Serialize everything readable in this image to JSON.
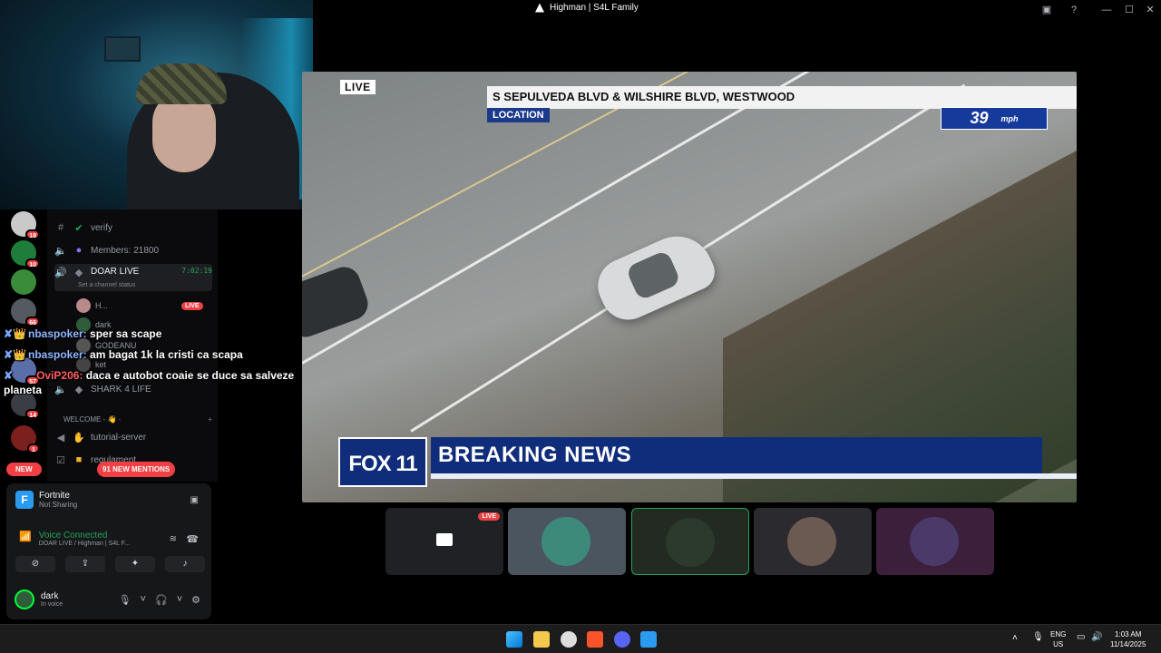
{
  "window": {
    "title": "Highman | S4L Family",
    "controls": {
      "minimize": "—",
      "maximize": "☐",
      "close": "✕"
    }
  },
  "servers": [
    {
      "badge": "18",
      "color": "#c9c9c9"
    },
    {
      "badge": "10",
      "color": "#1e7d3b"
    },
    {
      "badge": "",
      "color": "#3a8b3a"
    },
    {
      "badge": "66",
      "color": "#555a60"
    },
    {
      "badge": "57",
      "color": "#5a6fa8"
    },
    {
      "badge": "14",
      "color": "#3b3d44"
    },
    {
      "badge": "1",
      "color": "#7b1f1f"
    }
  ],
  "channels": {
    "verify": "verify",
    "members": "Members: 21800",
    "doar_live": "DOAR LIVE",
    "doar_live_timer": "7:02:19",
    "channel_status": "Set a channel status",
    "shark": "SHARK 4 LIFE",
    "welcome_category": "WELCOME - 👋 ·",
    "tutorial": "tutorial-server",
    "regulament": "regulament",
    "voice_users": [
      {
        "name": "H...",
        "live": "LIVE"
      },
      {
        "name": "dark",
        "live": ""
      },
      {
        "name": "GODEANU",
        "live": ""
      },
      {
        "name": "ket",
        "live": ""
      }
    ]
  },
  "chat": [
    {
      "user": "nbaspoker:",
      "message": "sper sa scape",
      "user_color": "#8fb6ff"
    },
    {
      "user": "nbaspoker:",
      "message": "am bagat 1k la cristi ca scapa",
      "user_color": "#8fb6ff"
    },
    {
      "user": "OviP206:",
      "message": "daca e autobot coaie se duce sa salveze planeta",
      "user_color": "#ff5c5c"
    }
  ],
  "pills": {
    "new": "NEW",
    "mentions": "91 NEW MENTIONS"
  },
  "panel": {
    "activity_name": "Fortnite",
    "activity_status": "Not Sharing",
    "voice_status": "Voice Connected",
    "voice_location": "DOAR LIVE / Highman | S4L F...",
    "user_name": "dark",
    "user_status": "In voice"
  },
  "video": {
    "live": "LIVE",
    "location_text": "S SEPULVEDA BLVD & WILSHIRE BLVD, WESTWOOD",
    "location_tag": "LOCATION",
    "speed_value": "39",
    "speed_unit": "mph",
    "network": "FOX 11",
    "headline": "BREAKING NEWS"
  },
  "participants": [
    {
      "type": "screen",
      "live": "LIVE",
      "color": "#4b4f55"
    },
    {
      "type": "avatar",
      "live": "",
      "color": "#3d8a7a"
    },
    {
      "type": "avatar",
      "live": "",
      "color": "#2b3a2a"
    },
    {
      "type": "avatar",
      "live": "",
      "color": "#6b5a52"
    },
    {
      "type": "avatar",
      "live": "",
      "color": "#4a3a6a"
    }
  ],
  "taskbar": {
    "lang": "ENG",
    "region": "US",
    "time": "1:03 AM",
    "date": "11/14/2025"
  }
}
